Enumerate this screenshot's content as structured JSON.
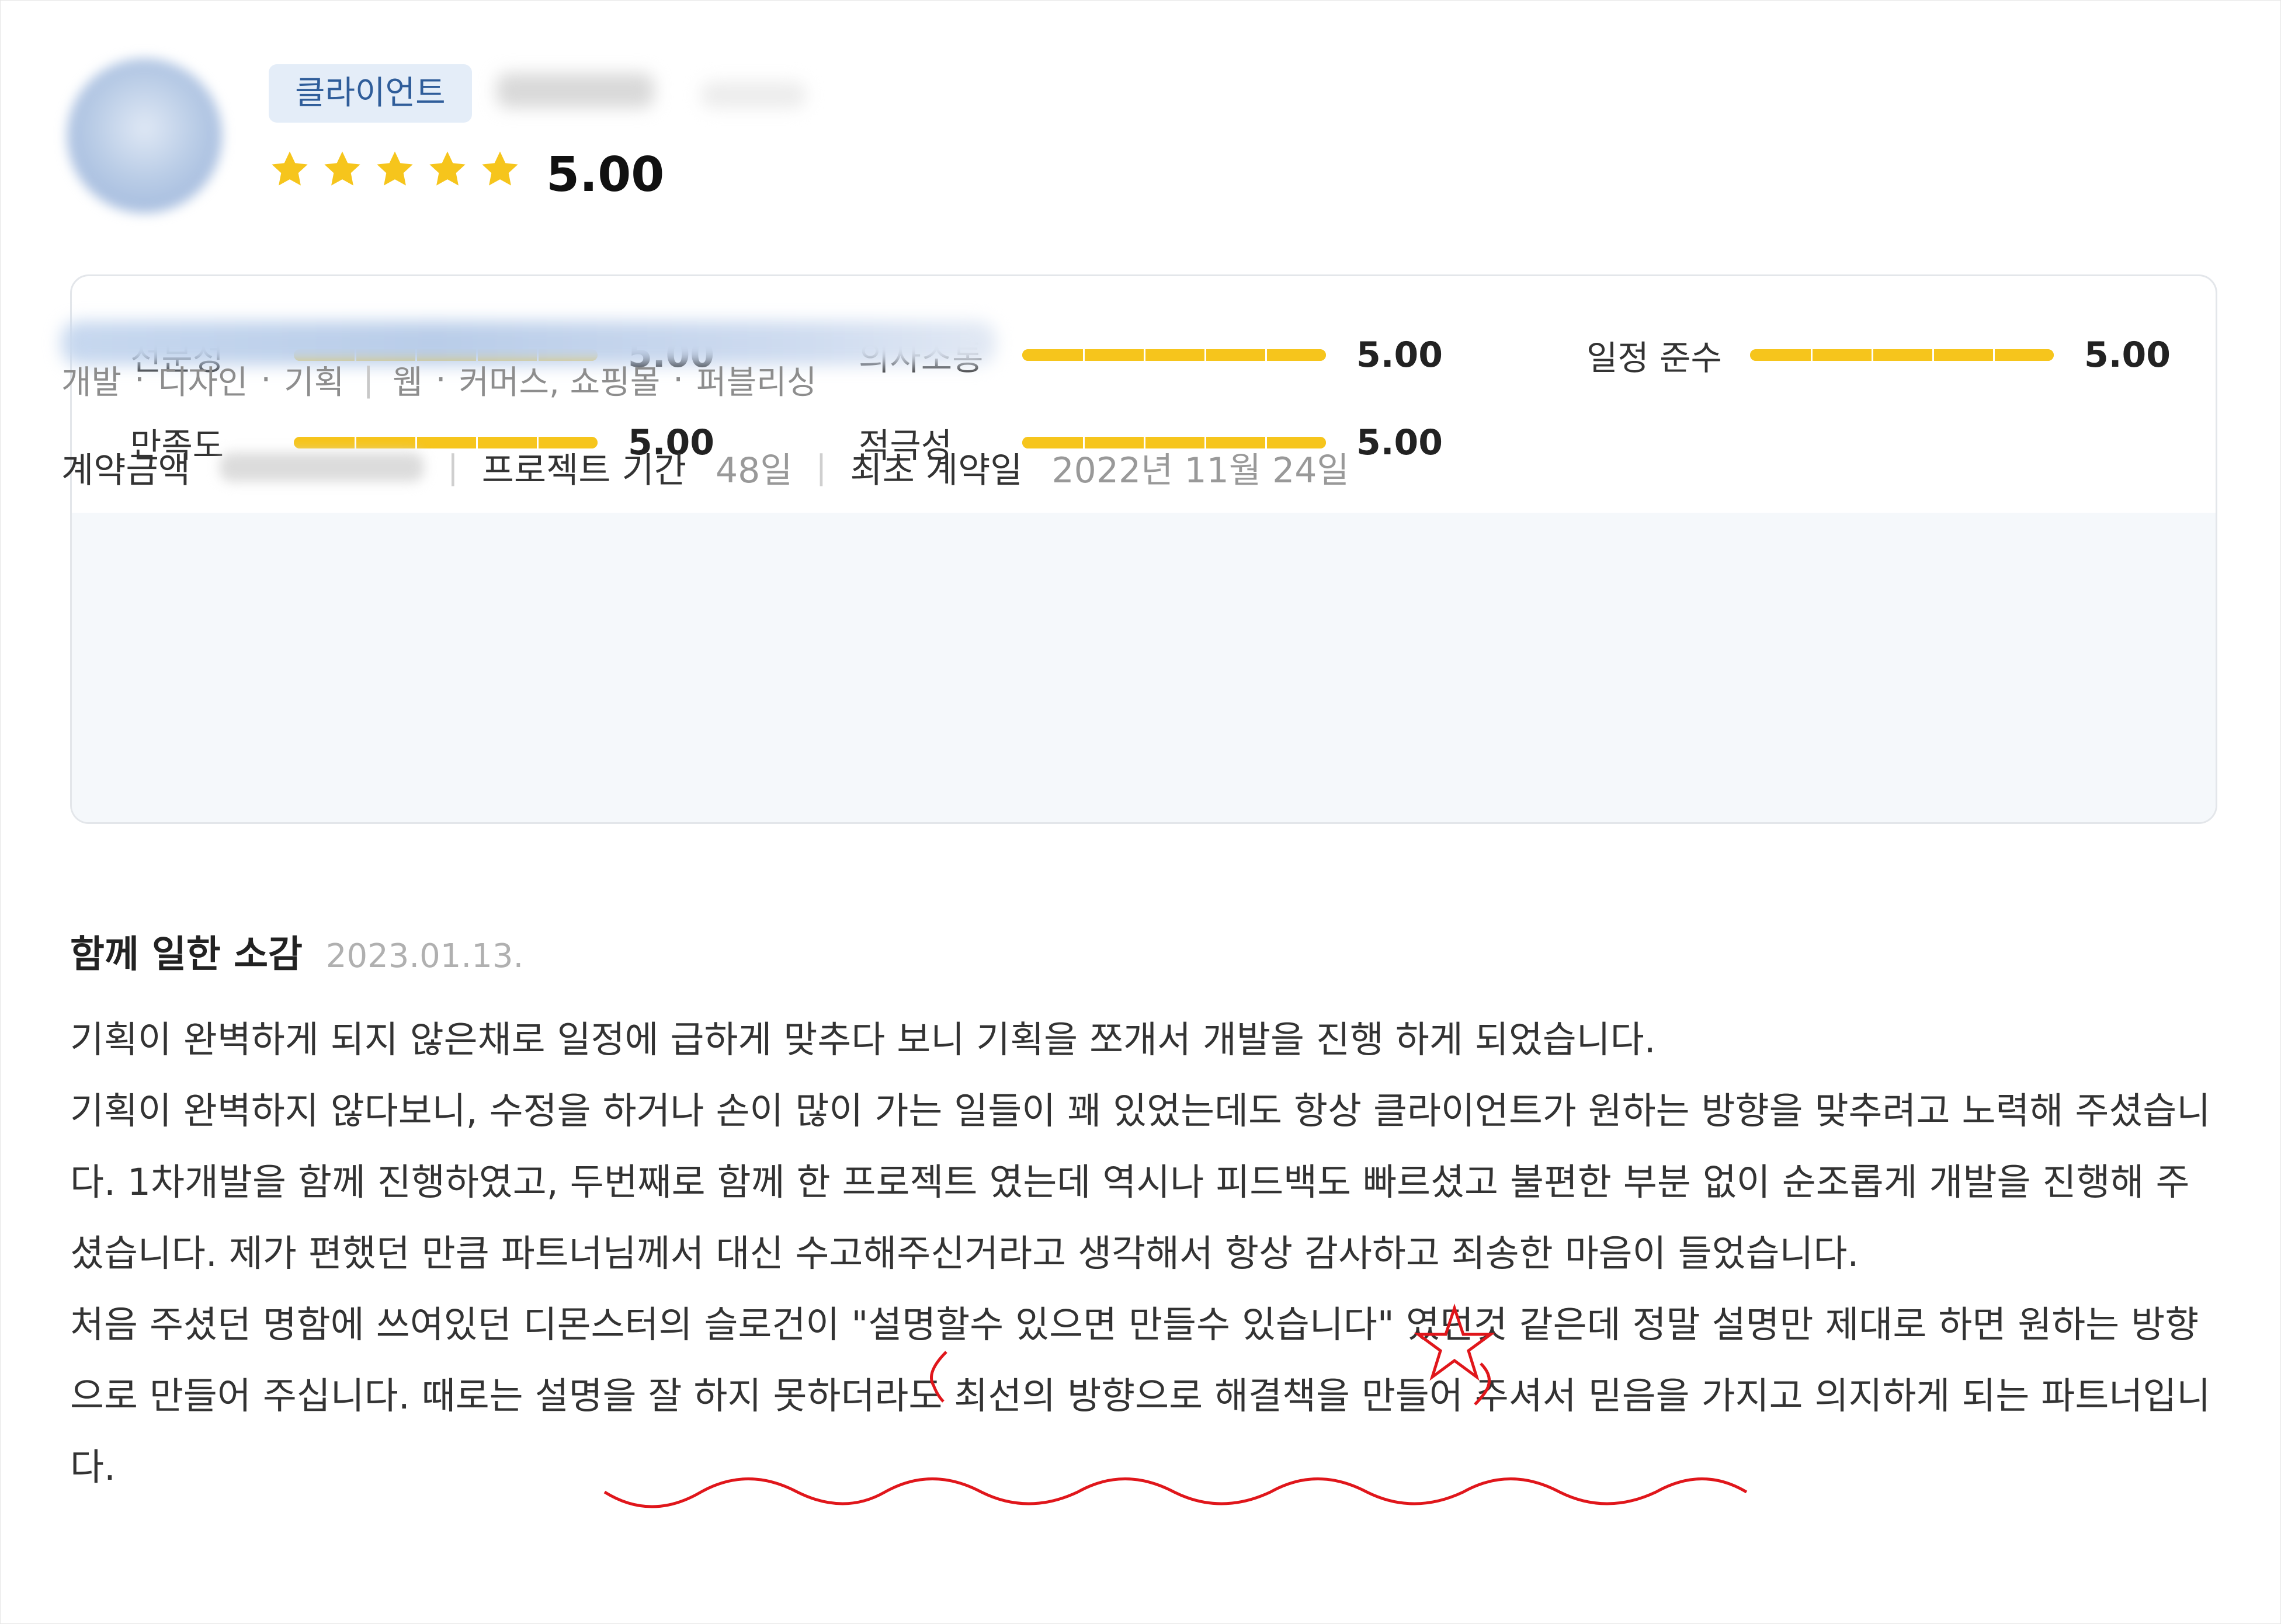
{
  "header": {
    "role_badge": "클라이언트",
    "rating": "5.00",
    "stars_filled": 5,
    "stars_total": 5
  },
  "metrics": [
    {
      "label": "전문성",
      "value": "5.00",
      "fraction": 1.0
    },
    {
      "label": "의사소통",
      "value": "5.00",
      "fraction": 1.0
    },
    {
      "label": "일정 준수",
      "value": "5.00",
      "fraction": 1.0
    },
    {
      "label": "만족도",
      "value": "5.00",
      "fraction": 1.0
    },
    {
      "label": "적극성",
      "value": "5.00",
      "fraction": 1.0
    }
  ],
  "project": {
    "categories": [
      "개발",
      "디자인",
      "기획"
    ],
    "fields": [
      "웹",
      "커머스, 쇼핑몰",
      "퍼블리싱"
    ],
    "contract_amount_label": "계약금액",
    "period_label": "프로젝트 기간",
    "period_value": "48일",
    "first_contract_label": "최초 계약일",
    "first_contract_value": "2022년 11월 24일"
  },
  "review": {
    "title": "함께 일한 소감",
    "date": "2023.01.13.",
    "paragraphs": [
      "기획이 완벽하게 되지 않은채로 일정에 급하게 맞추다 보니 기획을 쪼개서 개발을 진행 하게 되었습니다.",
      "기획이 완벽하지 않다보니, 수정을 하거나 손이 많이 가는 일들이 꽤 있었는데도 항상 클라이언트가 원하는 방향을 맞추려고 노력해 주셨습니다. 1차개발을 함께 진행하였고, 두번째로 함께 한 프로젝트 였는데 역시나 피드백도 빠르셨고 불편한 부분 없이 순조롭게 개발을 진행해 주셨습니다. 제가 편했던 만큼 파트너님께서 대신 수고해주신거라고 생각해서 항상 감사하고 죄송한 마음이 들었습니다.",
      "처음 주셨던 명함에 쓰여있던 디몬스터의 슬로건이 \"설명할수 있으면 만들수 있습니다\" 였던것 같은데 정말 설명만 제대로 하면 원하는 방향으로 만들어 주십니다. 때로는 설명을 잘 하지 못하더라도 최선의 방향으로 해결책을 만들어 주셔서 믿음을 가지고 의지하게 되는 파트너입니다."
    ]
  },
  "colors": {
    "star": "#f6c51c",
    "badge_bg": "#e4edf8",
    "badge_text": "#2f5d9a",
    "annotation": "#e0161b"
  }
}
